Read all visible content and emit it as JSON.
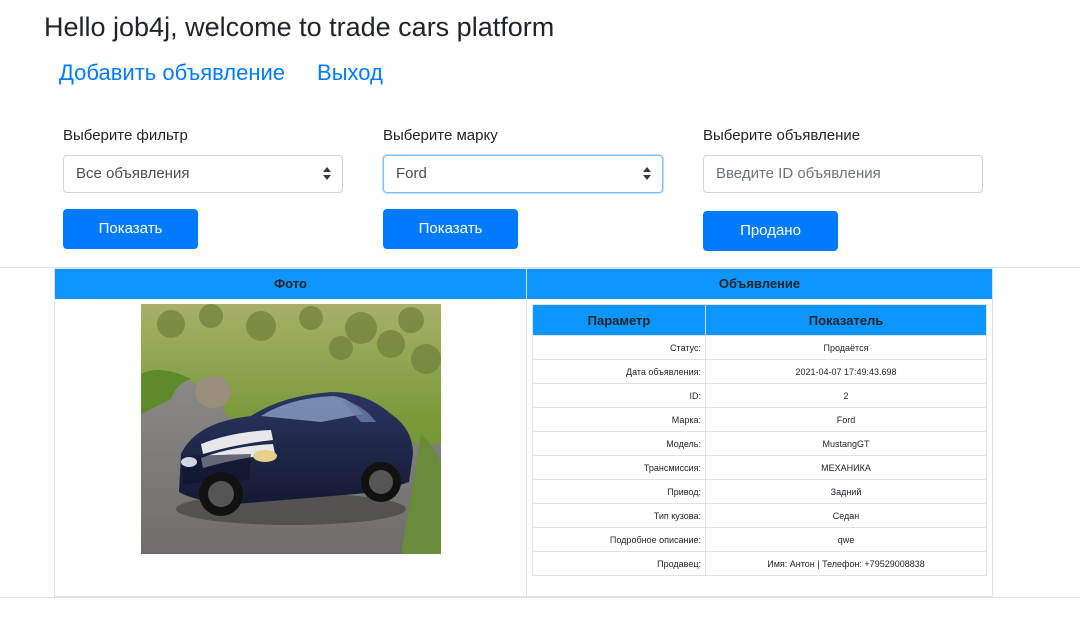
{
  "header": {
    "title": "Hello job4j, welcome to trade cars platform",
    "nav": {
      "add_listing": "Добавить объявление",
      "logout": "Выход"
    }
  },
  "filters": {
    "filter": {
      "label": "Выберите фильтр",
      "selected": "Все объявления",
      "button": "Показать"
    },
    "brand": {
      "label": "Выберите марку",
      "selected": "Ford",
      "button": "Показать"
    },
    "listing": {
      "label": "Выберите объявление",
      "placeholder": "Введите ID объявления",
      "button": "Продано"
    }
  },
  "table": {
    "col_photo": "Фото",
    "col_listing": "Объявление",
    "details": {
      "col_param": "Параметр",
      "col_value": "Показатель",
      "rows": [
        {
          "param": "Статус:",
          "value": "Продаётся"
        },
        {
          "param": "Дата объявления:",
          "value": "2021-04-07 17:49:43.698"
        },
        {
          "param": "ID:",
          "value": "2"
        },
        {
          "param": "Марка:",
          "value": "Ford"
        },
        {
          "param": "Модель:",
          "value": "MustangGT"
        },
        {
          "param": "Трансмиссия:",
          "value": "МЕХАНИКА"
        },
        {
          "param": "Привод:",
          "value": "Задний"
        },
        {
          "param": "Тип кузова:",
          "value": "Седан"
        },
        {
          "param": "Подробное описание:",
          "value": "qwe"
        },
        {
          "param": "Продавец:",
          "value": "Имя: Антон | Телефон: +79529008838"
        }
      ]
    }
  },
  "colors": {
    "primary": "#007bff",
    "table_header": "#0d96ff",
    "border": "#dee2e6",
    "car_body": "#1c2340"
  }
}
